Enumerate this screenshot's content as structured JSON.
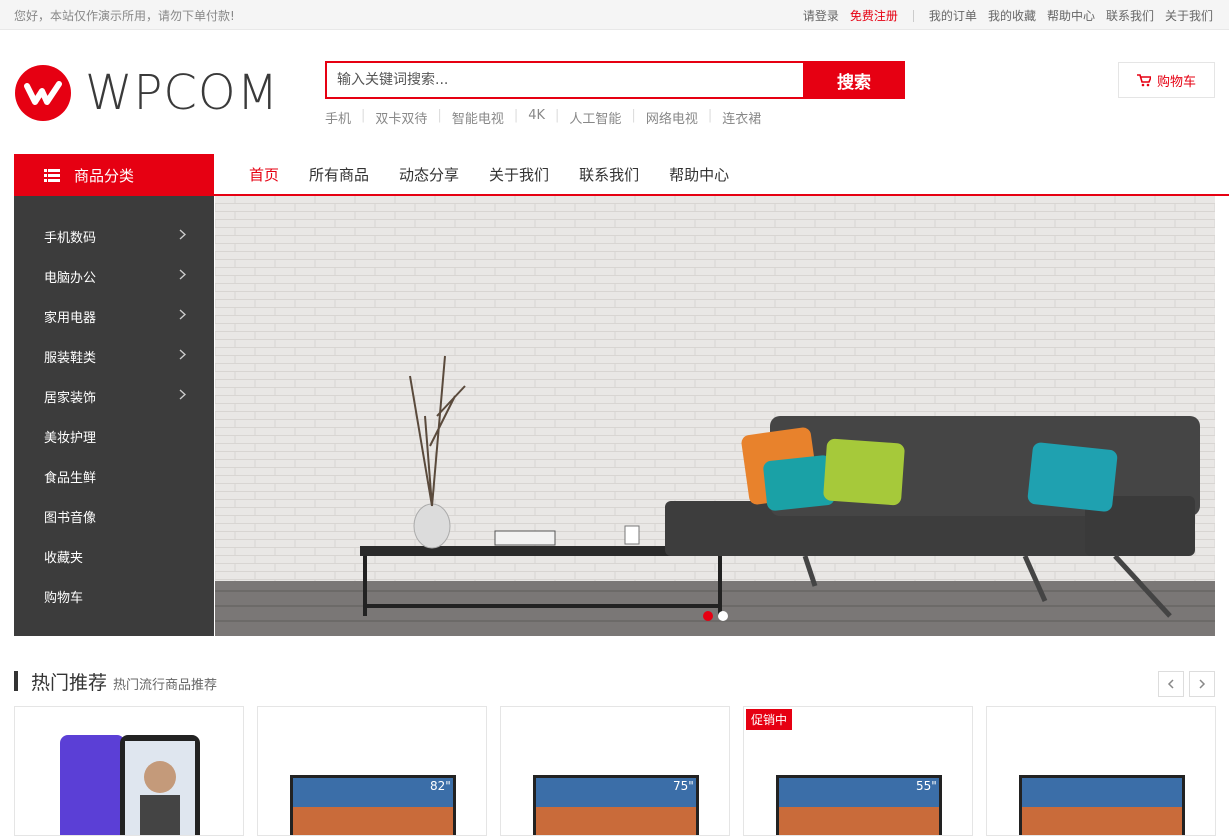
{
  "topbar": {
    "notice": "您好，本站仅作演示所用，请勿下单付款!",
    "login": "请登录",
    "register": "免费注册",
    "links": [
      "我的订单",
      "我的收藏",
      "帮助中心",
      "联系我们",
      "关于我们"
    ]
  },
  "logo": {
    "text": "WPCOM"
  },
  "search": {
    "placeholder": "输入关键词搜索...",
    "button": "搜索"
  },
  "hotwords": [
    "手机",
    "双卡双待",
    "智能电视",
    "4K",
    "人工智能",
    "网络电视",
    "连衣裙"
  ],
  "cart": {
    "label": "购物车"
  },
  "nav": {
    "category_label": "商品分类",
    "links": [
      "首页",
      "所有商品",
      "动态分享",
      "关于我们",
      "联系我们",
      "帮助中心"
    ],
    "active_index": 0
  },
  "sidebar": {
    "items": [
      {
        "label": "手机数码",
        "has_arrow": true
      },
      {
        "label": "电脑办公",
        "has_arrow": true
      },
      {
        "label": "家用电器",
        "has_arrow": true
      },
      {
        "label": "服装鞋类",
        "has_arrow": true
      },
      {
        "label": "居家装饰",
        "has_arrow": true
      },
      {
        "label": "美妆护理",
        "has_arrow": false
      },
      {
        "label": "食品生鲜",
        "has_arrow": false
      },
      {
        "label": "图书音像",
        "has_arrow": false
      },
      {
        "label": "收藏夹",
        "has_arrow": false
      },
      {
        "label": "购物车",
        "has_arrow": false
      }
    ]
  },
  "banner": {
    "slides": 2,
    "active_slide": 0
  },
  "section": {
    "title": "热门推荐",
    "subtitle": "热门流行商品推荐"
  },
  "products": [
    {
      "badge": "",
      "image": "phone"
    },
    {
      "badge": "",
      "image": "tv",
      "size_label": "82\""
    },
    {
      "badge": "",
      "image": "tv",
      "size_label": "75\""
    },
    {
      "badge": "促销中",
      "image": "tv",
      "size_label": "55\""
    },
    {
      "badge": "",
      "image": "tv",
      "size_label": ""
    }
  ],
  "colors": {
    "accent": "#e60012",
    "sidebar": "#3c3c3c"
  }
}
